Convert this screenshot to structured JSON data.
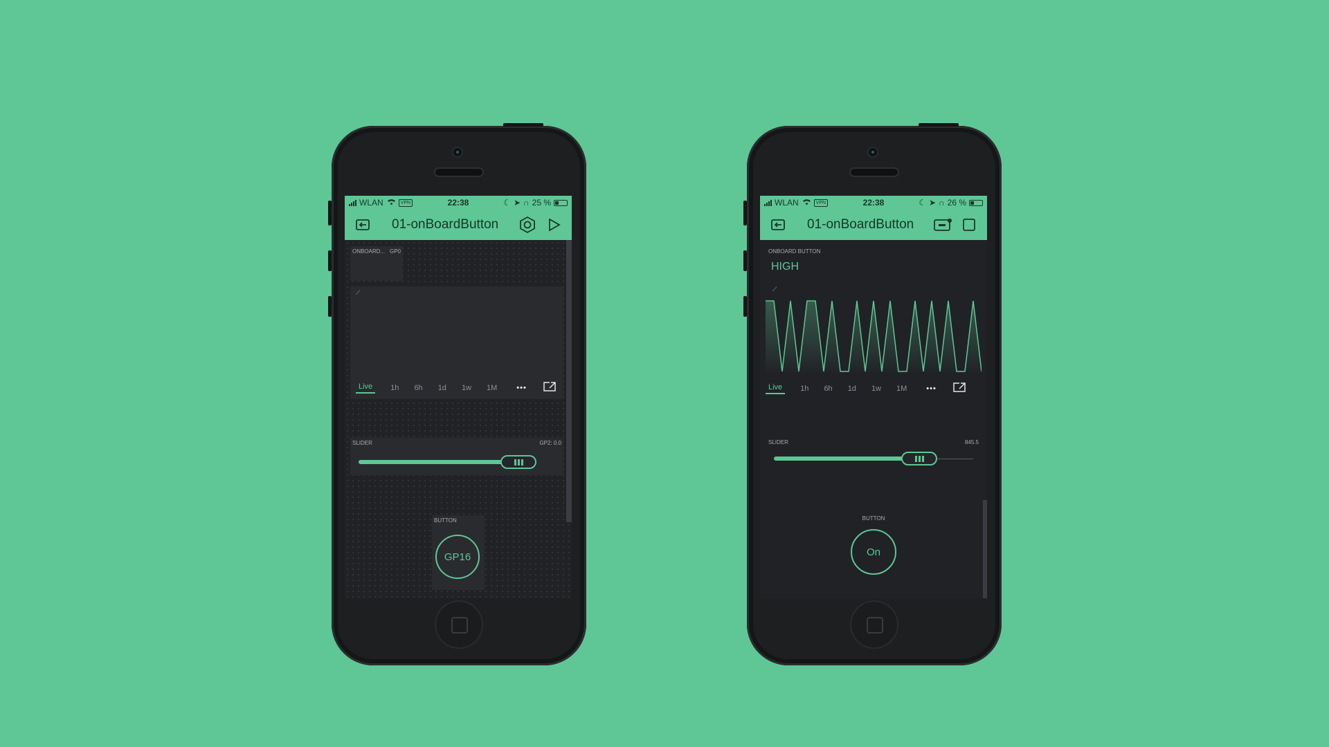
{
  "colors": {
    "background": "#5ec795",
    "accent": "#5ec795",
    "panel": "#2a2b2f",
    "screen": "#212226"
  },
  "phones": [
    {
      "status": {
        "carrier": "WLAN",
        "vpn": "VPN",
        "time": "22:38",
        "battery": "25 %"
      },
      "header": {
        "title": "01-onBoardButton",
        "left_icon": "project-icon",
        "icon2": "settings-icon",
        "icon3": "play-icon"
      },
      "onboard_widget": {
        "label": "ONBOARD...",
        "pin": "GP0"
      },
      "chart": {
        "tabs": [
          "Live",
          "1h",
          "6h",
          "1d",
          "1w",
          "1M"
        ],
        "active_tab": "Live"
      },
      "slider": {
        "label": "SLIDER",
        "value_text": "GP2: 0.0",
        "level": 0.85
      },
      "button": {
        "label": "BUTTON",
        "text": "GP16"
      }
    },
    {
      "status": {
        "carrier": "WLAN",
        "vpn": "VPN",
        "time": "22:38",
        "battery": "26 %"
      },
      "header": {
        "title": "01-onBoardButton",
        "left_icon": "project-icon",
        "icon2": "device-icon",
        "icon3": "stop-icon"
      },
      "onboard_widget": {
        "label": "ONBOARD BUTTON",
        "value": "HIGH"
      },
      "chart": {
        "tabs": [
          "Live",
          "1h",
          "6h",
          "1d",
          "1w",
          "1M"
        ],
        "active_tab": "Live"
      },
      "slider": {
        "label": "SLIDER",
        "value_text": "845.5",
        "level": 0.73
      },
      "button": {
        "label": "BUTTON",
        "text": "On"
      }
    }
  ],
  "chart_data": {
    "type": "line",
    "series": [
      {
        "values": [
          1,
          1,
          0,
          1,
          0,
          1,
          1,
          0,
          1,
          0,
          0,
          1,
          0,
          1,
          0,
          1,
          0,
          0,
          1,
          0,
          1,
          0,
          1,
          0,
          0,
          1,
          0
        ]
      }
    ]
  }
}
